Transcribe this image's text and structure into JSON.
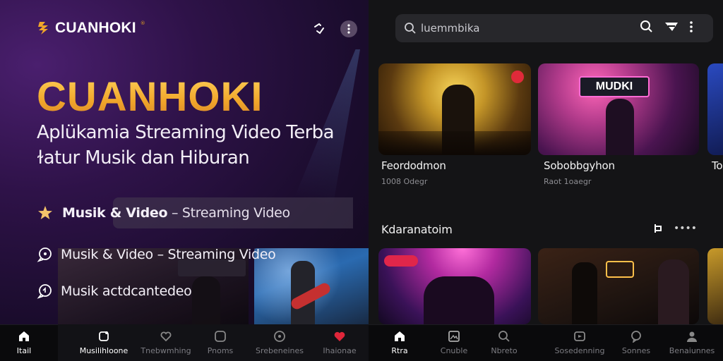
{
  "app": {
    "brand": "CUANHOKI",
    "brand_mark": "®"
  },
  "hero": {
    "title": "CUANHOKI",
    "subtitle_line1": "Aplükamia Streaming Video Terba",
    "subtitle_line2": "ɫatur Musik dan Hiburan"
  },
  "features": [
    {
      "icon": "star-icon",
      "bold": "Musik & Video",
      "text": " – Streaming Video"
    },
    {
      "icon": "chat-bubble-icon",
      "bold": "",
      "text": "Musik & Video – Streaming Video"
    },
    {
      "icon": "chat-bubble-icon",
      "bold": "",
      "text": "Musik actdcantedeo"
    }
  ],
  "search": {
    "value": "luemmbika"
  },
  "cards_top": [
    {
      "title": "Feordodmon",
      "meta": "1008 Odegr"
    },
    {
      "title": "Sobobbgyhon",
      "meta": "Raot 1oaegr",
      "sign": "MUDKI"
    },
    {
      "title": "To"
    }
  ],
  "section": {
    "title": "Kdaranatoim",
    "more": "••••"
  },
  "bottom_nav": [
    {
      "label": "Itail",
      "icon": "home-icon",
      "active": true
    },
    {
      "label": "Musilihloone",
      "icon": "music-note-icon",
      "active": true
    },
    {
      "label": "Tnebwmhing",
      "icon": "heart-outline-icon",
      "active": false
    },
    {
      "label": "Pnoms",
      "icon": "square-icon",
      "active": false
    },
    {
      "label": "Srebeneines",
      "icon": "disc-icon",
      "active": false
    },
    {
      "label": "Ihaionae",
      "icon": "heart-icon",
      "active": false
    },
    {
      "label": "Rtra",
      "icon": "home-icon",
      "active": true
    },
    {
      "label": "Cnuble",
      "icon": "image-icon",
      "active": false
    },
    {
      "label": "Nbreto",
      "icon": "search-icon",
      "active": false
    },
    {
      "label": "Sosedenning",
      "icon": "video-icon",
      "active": false
    },
    {
      "label": "Sonnes",
      "icon": "chat-icon",
      "active": false
    },
    {
      "label": "Benaiunnes",
      "icon": "user-icon",
      "active": false
    }
  ],
  "colors": {
    "accent": "#f0a52a",
    "heart": "#e0263a",
    "badge": "#e02a3a"
  }
}
